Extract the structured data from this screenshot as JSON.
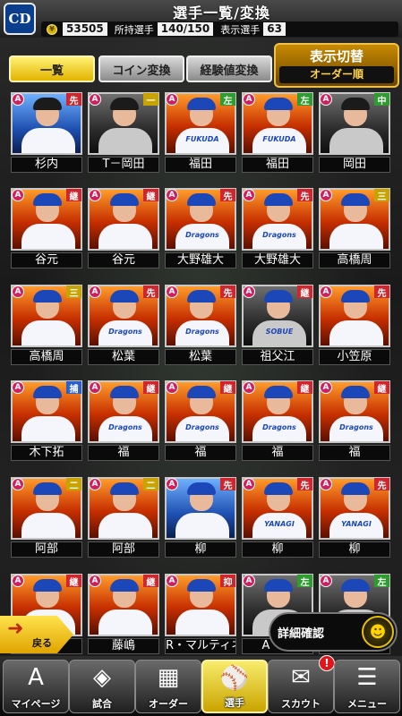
{
  "header": {
    "logo_text": "CD",
    "title": "選手一覧/変換",
    "coin_icon": "coin-icon",
    "coins": "53505",
    "owned_label": "所持選手",
    "owned_value": "140/150",
    "shown_label": "表示選手",
    "shown_value": "63"
  },
  "tabs": {
    "list": "一覧",
    "coin_convert": "コイン変換",
    "exp_convert": "経験値変換",
    "display_toggle": "表示切替",
    "order": "オーダー順"
  },
  "colors": {
    "pos_red": "#d0252c",
    "pos_yellow": "#c9a400",
    "pos_green": "#2e9c2e",
    "pos_blue": "#2a5fd0",
    "rank": "#d01f5e"
  },
  "players": [
    {
      "rank": "A",
      "pos": "先",
      "name": "杉内",
      "bg": "blue",
      "cap": "black",
      "jersey": "",
      "pos_color": "pos_red"
    },
    {
      "rank": "A",
      "pos": "一",
      "name": "T－岡田",
      "bg": "dark",
      "cap": "black",
      "jersey": "",
      "pos_color": "pos_yellow"
    },
    {
      "rank": "A",
      "pos": "左",
      "name": "福田",
      "bg": "orange",
      "cap": "blue",
      "jersey": "FUKUDA",
      "pos_color": "pos_green"
    },
    {
      "rank": "A",
      "pos": "左",
      "name": "福田",
      "bg": "orange",
      "cap": "blue",
      "jersey": "FUKUDA",
      "pos_color": "pos_green"
    },
    {
      "rank": "A",
      "pos": "中",
      "name": "岡田",
      "bg": "dark",
      "cap": "black",
      "jersey": "",
      "pos_color": "pos_green"
    },
    {
      "rank": "A",
      "pos": "継",
      "name": "谷元",
      "bg": "orange",
      "cap": "blue",
      "jersey": "",
      "pos_color": "pos_red"
    },
    {
      "rank": "A",
      "pos": "継",
      "name": "谷元",
      "bg": "orange",
      "cap": "blue",
      "jersey": "",
      "pos_color": "pos_red"
    },
    {
      "rank": "A",
      "pos": "先",
      "name": "大野雄大",
      "bg": "orange",
      "cap": "blue",
      "jersey": "Dragons",
      "pos_color": "pos_red"
    },
    {
      "rank": "A",
      "pos": "先",
      "name": "大野雄大",
      "bg": "orange",
      "cap": "blue",
      "jersey": "Dragons",
      "pos_color": "pos_red"
    },
    {
      "rank": "A",
      "pos": "三",
      "name": "高橋周",
      "bg": "orange",
      "cap": "blue",
      "jersey": "",
      "pos_color": "pos_yellow"
    },
    {
      "rank": "A",
      "pos": "三",
      "name": "高橋周",
      "bg": "orange",
      "cap": "blue",
      "jersey": "",
      "pos_color": "pos_yellow"
    },
    {
      "rank": "A",
      "pos": "先",
      "name": "松葉",
      "bg": "orange",
      "cap": "blue",
      "jersey": "Dragons",
      "pos_color": "pos_red"
    },
    {
      "rank": "A",
      "pos": "先",
      "name": "松葉",
      "bg": "orange",
      "cap": "blue",
      "jersey": "Dragons",
      "pos_color": "pos_red"
    },
    {
      "rank": "A",
      "pos": "継",
      "name": "祖父江",
      "bg": "dark",
      "cap": "blue",
      "jersey": "SOBUE",
      "pos_color": "pos_red"
    },
    {
      "rank": "A",
      "pos": "先",
      "name": "小笠原",
      "bg": "orange",
      "cap": "blue",
      "jersey": "",
      "pos_color": "pos_red"
    },
    {
      "rank": "A",
      "pos": "捕",
      "name": "木下拓",
      "bg": "orange",
      "cap": "blue",
      "jersey": "",
      "pos_color": "pos_blue"
    },
    {
      "rank": "A",
      "pos": "継",
      "name": "福",
      "bg": "orange",
      "cap": "blue",
      "jersey": "Dragons",
      "pos_color": "pos_red"
    },
    {
      "rank": "A",
      "pos": "継",
      "name": "福",
      "bg": "orange",
      "cap": "blue",
      "jersey": "Dragons",
      "pos_color": "pos_red"
    },
    {
      "rank": "A",
      "pos": "継",
      "name": "福",
      "bg": "orange",
      "cap": "blue",
      "jersey": "Dragons",
      "pos_color": "pos_red"
    },
    {
      "rank": "A",
      "pos": "継",
      "name": "福",
      "bg": "orange",
      "cap": "blue",
      "jersey": "Dragons",
      "pos_color": "pos_red"
    },
    {
      "rank": "A",
      "pos": "二",
      "name": "阿部",
      "bg": "orange",
      "cap": "blue",
      "jersey": "",
      "pos_color": "pos_yellow"
    },
    {
      "rank": "A",
      "pos": "二",
      "name": "阿部",
      "bg": "orange",
      "cap": "blue",
      "jersey": "",
      "pos_color": "pos_yellow"
    },
    {
      "rank": "A",
      "pos": "先",
      "name": "柳",
      "bg": "blue",
      "cap": "blue",
      "jersey": "",
      "pos_color": "pos_red"
    },
    {
      "rank": "A",
      "pos": "先",
      "name": "柳",
      "bg": "orange",
      "cap": "blue",
      "jersey": "YANAGI",
      "pos_color": "pos_red"
    },
    {
      "rank": "A",
      "pos": "先",
      "name": "柳",
      "bg": "orange",
      "cap": "blue",
      "jersey": "YANAGI",
      "pos_color": "pos_red"
    },
    {
      "rank": "A",
      "pos": "継",
      "name": "",
      "bg": "orange",
      "cap": "blue",
      "jersey": "",
      "pos_color": "pos_red"
    },
    {
      "rank": "A",
      "pos": "継",
      "name": "藤嶋",
      "bg": "orange",
      "cap": "blue",
      "jersey": "",
      "pos_color": "pos_red"
    },
    {
      "rank": "A",
      "pos": "抑",
      "name": "R・マルティネス",
      "bg": "orange",
      "cap": "blue",
      "jersey": "",
      "pos_color": "pos_red"
    },
    {
      "rank": "A",
      "pos": "左",
      "name": "A・マ",
      "bg": "dark",
      "cap": "blue",
      "jersey": "",
      "pos_color": "pos_green"
    },
    {
      "rank": "A",
      "pos": "左",
      "name": "",
      "bg": "dark",
      "cap": "blue",
      "jersey": "",
      "pos_color": "pos_green"
    }
  ],
  "overlay": {
    "back_icon": "back-arrow-icon",
    "back_label": "戻る",
    "detail_label": "詳細確認",
    "detail_icon": "person-icon"
  },
  "nav": [
    {
      "id": "mypage",
      "label": "マイページ",
      "icon": "A",
      "active": false,
      "badge": ""
    },
    {
      "id": "match",
      "label": "試合",
      "icon": "◈",
      "active": false,
      "badge": ""
    },
    {
      "id": "order",
      "label": "オーダー",
      "icon": "▦",
      "active": false,
      "badge": ""
    },
    {
      "id": "players",
      "label": "選手",
      "icon": "⚾",
      "active": true,
      "badge": ""
    },
    {
      "id": "scout",
      "label": "スカウト",
      "icon": "✉",
      "active": false,
      "badge": "!"
    },
    {
      "id": "menu",
      "label": "メニュー",
      "icon": "☰",
      "active": false,
      "badge": ""
    }
  ]
}
